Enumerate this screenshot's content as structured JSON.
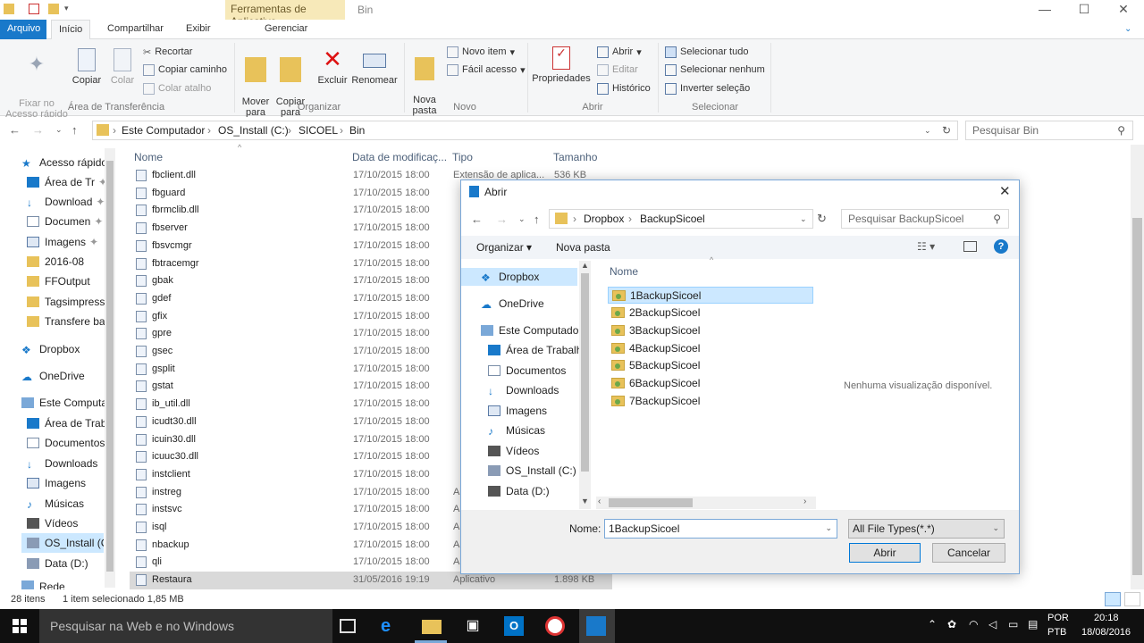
{
  "window": {
    "context_tab": "Ferramentas de Aplicativo",
    "title": "Bin",
    "controls": {
      "minimize": "—",
      "maximize": "☐",
      "close": "✕"
    }
  },
  "tabs": [
    "Arquivo",
    "Início",
    "Compartilhar",
    "Exibir",
    "Gerenciar"
  ],
  "ribbon": {
    "clipboard": {
      "pin": "Fixar no\nAcesso rápido",
      "copy": "Copiar",
      "paste": "Colar",
      "cut": "Recortar",
      "copy_path": "Copiar caminho",
      "paste_shortcut": "Colar atalho",
      "group": "Área de Transferência"
    },
    "organize": {
      "move": "Mover\npara",
      "copy_to": "Copiar\npara",
      "delete": "Excluir",
      "rename": "Renomear",
      "group": "Organizar"
    },
    "new": {
      "new_folder": "Nova\npasta",
      "new_item": "Novo item",
      "easy_access": "Fácil acesso",
      "group": "Novo"
    },
    "open": {
      "properties": "Propriedades",
      "open": "Abrir",
      "edit": "Editar",
      "history": "Histórico",
      "group": "Abrir"
    },
    "select": {
      "select_all": "Selecionar tudo",
      "select_none": "Selecionar nenhum",
      "invert": "Inverter seleção",
      "group": "Selecionar"
    }
  },
  "address": {
    "crumbs": [
      "Este Computador",
      "OS_Install (C:)",
      "SICOEL",
      "Bin"
    ],
    "search_placeholder": "Pesquisar Bin"
  },
  "nav": [
    "Acesso rápido",
    "Área de Tr",
    "Download",
    "Documen",
    "Imagens",
    "2016-08",
    "FFOutput",
    "Tagsimpressã",
    "Transfere bar",
    "Dropbox",
    "OneDrive",
    "Este Computad",
    "Área de Traba",
    "Documentos",
    "Downloads",
    "Imagens",
    "Músicas",
    "Vídeos",
    "OS_Install (C:",
    "Data (D:)",
    "Rede"
  ],
  "columns": [
    "Nome",
    "Data de modificaç...",
    "Tipo",
    "Tamanho"
  ],
  "files": [
    {
      "name": "fbclient.dll",
      "date": "17/10/2015 18:00",
      "type": "Extensão de aplica...",
      "size": "536 KB"
    },
    {
      "name": "fbguard",
      "date": "17/10/2015 18:00",
      "type": "",
      "size": ""
    },
    {
      "name": "fbrmclib.dll",
      "date": "17/10/2015 18:00",
      "type": "",
      "size": ""
    },
    {
      "name": "fbserver",
      "date": "17/10/2015 18:00",
      "type": "",
      "size": ""
    },
    {
      "name": "fbsvcmgr",
      "date": "17/10/2015 18:00",
      "type": "",
      "size": ""
    },
    {
      "name": "fbtracemgr",
      "date": "17/10/2015 18:00",
      "type": "",
      "size": ""
    },
    {
      "name": "gbak",
      "date": "17/10/2015 18:00",
      "type": "",
      "size": ""
    },
    {
      "name": "gdef",
      "date": "17/10/2015 18:00",
      "type": "",
      "size": ""
    },
    {
      "name": "gfix",
      "date": "17/10/2015 18:00",
      "type": "",
      "size": ""
    },
    {
      "name": "gpre",
      "date": "17/10/2015 18:00",
      "type": "",
      "size": ""
    },
    {
      "name": "gsec",
      "date": "17/10/2015 18:00",
      "type": "",
      "size": ""
    },
    {
      "name": "gsplit",
      "date": "17/10/2015 18:00",
      "type": "",
      "size": ""
    },
    {
      "name": "gstat",
      "date": "17/10/2015 18:00",
      "type": "",
      "size": ""
    },
    {
      "name": "ib_util.dll",
      "date": "17/10/2015 18:00",
      "type": "",
      "size": ""
    },
    {
      "name": "icudt30.dll",
      "date": "17/10/2015 18:00",
      "type": "",
      "size": ""
    },
    {
      "name": "icuin30.dll",
      "date": "17/10/2015 18:00",
      "type": "",
      "size": ""
    },
    {
      "name": "icuuc30.dll",
      "date": "17/10/2015 18:00",
      "type": "",
      "size": ""
    },
    {
      "name": "instclient",
      "date": "17/10/2015 18:00",
      "type": "",
      "size": ""
    },
    {
      "name": "instreg",
      "date": "17/10/2015 18:00",
      "type": "A",
      "size": ""
    },
    {
      "name": "instsvc",
      "date": "17/10/2015 18:00",
      "type": "A",
      "size": ""
    },
    {
      "name": "isql",
      "date": "17/10/2015 18:00",
      "type": "A",
      "size": ""
    },
    {
      "name": "nbackup",
      "date": "17/10/2015 18:00",
      "type": "A",
      "size": ""
    },
    {
      "name": "qli",
      "date": "17/10/2015 18:00",
      "type": "A",
      "size": ""
    },
    {
      "name": "Restaura",
      "date": "31/05/2016 19:19",
      "type": "Aplicativo",
      "size": "1.898 KB"
    }
  ],
  "status": {
    "count": "28 itens",
    "selected": "1 item selecionado  1,85 MB"
  },
  "dialog": {
    "title": "Abrir",
    "crumbs": [
      "Dropbox",
      "BackupSicoel"
    ],
    "search_placeholder": "Pesquisar BackupSicoel",
    "organize": "Organizar",
    "new_folder": "Nova pasta",
    "nav": [
      "Dropbox",
      "OneDrive",
      "Este Computador",
      "Área de Trabalho",
      "Documentos",
      "Downloads",
      "Imagens",
      "Músicas",
      "Vídeos",
      "OS_Install (C:)",
      "Data (D:)"
    ],
    "column": "Nome",
    "folders": [
      "1BackupSicoel",
      "2BackupSicoel",
      "3BackupSicoel",
      "4BackupSicoel",
      "5BackupSicoel",
      "6BackupSicoel",
      "7BackupSicoel"
    ],
    "preview": "Nenhuma visualização disponível.",
    "name_label": "Nome:",
    "name_value": "1BackupSicoel",
    "filter": "All File Types(*.*)",
    "open_button": "Abrir",
    "cancel_button": "Cancelar"
  },
  "taskbar": {
    "search": "Pesquisar na Web e no Windows",
    "lang1": "POR",
    "lang2": "PTB",
    "time": "20:18",
    "date": "18/08/2016"
  },
  "colors": {
    "accent": "#1979ca",
    "selection": "#cce8ff",
    "context_tab": "#f7e9b9",
    "taskbar": "#101010"
  }
}
